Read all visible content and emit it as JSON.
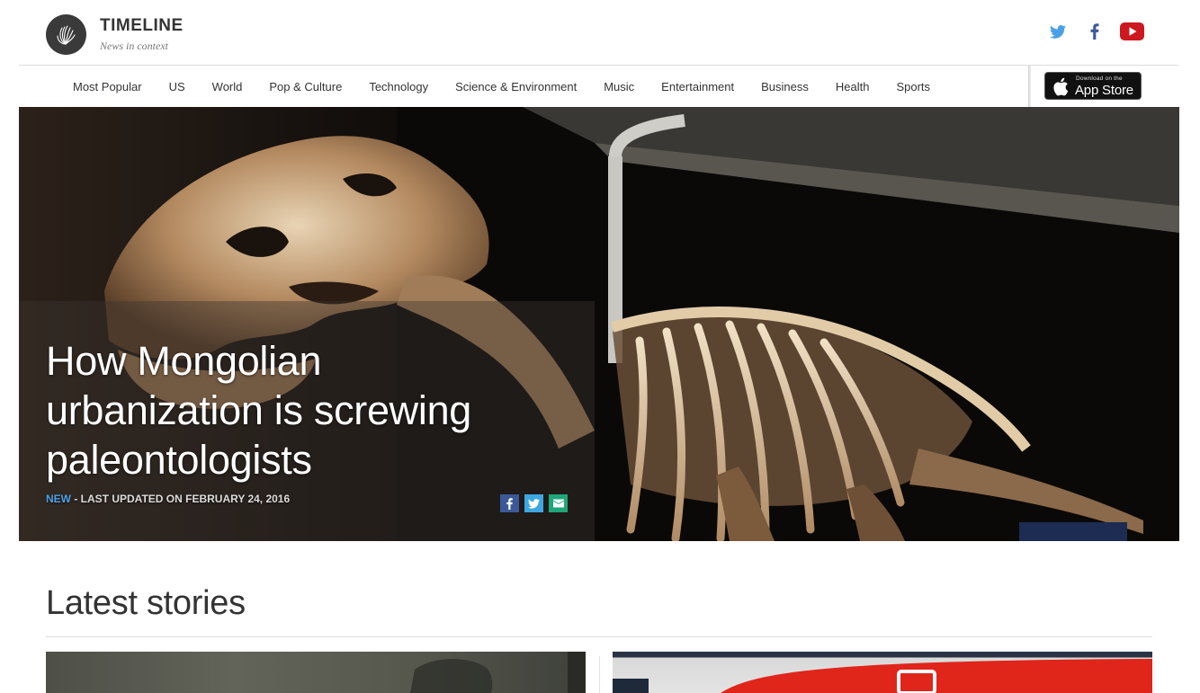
{
  "brand": {
    "name": "TIMELINE",
    "tagline": "News in context"
  },
  "social": {
    "icons": [
      "twitter-icon",
      "facebook-icon",
      "youtube-icon"
    ],
    "colors": {
      "twitter": "#4aa0e6",
      "facebook": "#3b5998",
      "youtube": "#cc181e"
    }
  },
  "nav": {
    "items": [
      {
        "label": "Most Popular"
      },
      {
        "label": "US"
      },
      {
        "label": "World"
      },
      {
        "label": "Pop & Culture"
      },
      {
        "label": "Technology"
      },
      {
        "label": "Science & Environment"
      },
      {
        "label": "Music"
      },
      {
        "label": "Entertainment"
      },
      {
        "label": "Business"
      },
      {
        "label": "Health"
      },
      {
        "label": "Sports"
      }
    ],
    "app_store": {
      "small": "Download on the",
      "big": "App Store"
    }
  },
  "hero": {
    "title": "How Mongolian urbanization is screwing paleontologists",
    "badge": "NEW",
    "updated": " - LAST UPDATED ON FEBRUARY 24, 2016",
    "share_icons": [
      "facebook-share-icon",
      "twitter-share-icon",
      "email-share-icon"
    ],
    "colors": {
      "badge": "#4aa0e6",
      "facebook": "#3b5998",
      "twitter": "#3fa7e0",
      "email": "#1fa67a"
    }
  },
  "latest": {
    "heading": "Latest stories"
  }
}
